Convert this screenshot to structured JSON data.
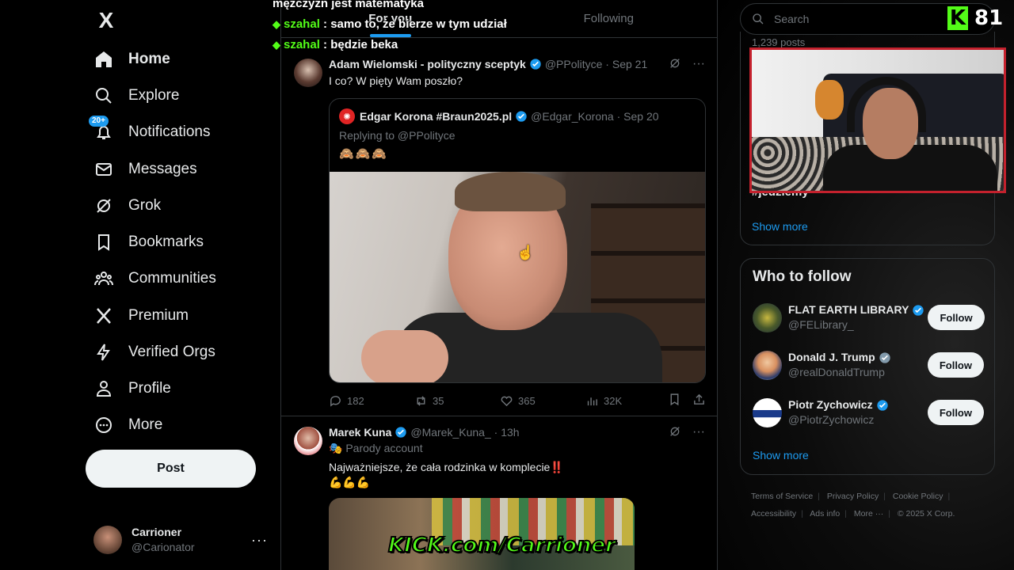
{
  "sidebar": {
    "logo": "X",
    "items": [
      {
        "label": "Home",
        "icon": "home-icon",
        "active": true
      },
      {
        "label": "Explore",
        "icon": "search-icon"
      },
      {
        "label": "Notifications",
        "icon": "bell-icon",
        "badge": "20+"
      },
      {
        "label": "Messages",
        "icon": "envelope-icon"
      },
      {
        "label": "Grok",
        "icon": "grok-icon"
      },
      {
        "label": "Bookmarks",
        "icon": "bookmark-icon"
      },
      {
        "label": "Communities",
        "icon": "people-icon"
      },
      {
        "label": "Premium",
        "icon": "x-icon"
      },
      {
        "label": "Verified Orgs",
        "icon": "lightning-icon"
      },
      {
        "label": "Profile",
        "icon": "person-icon"
      },
      {
        "label": "More",
        "icon": "more-circle-icon"
      }
    ],
    "post_button": "Post",
    "account": {
      "name": "Carrioner",
      "handle": "@Carionator",
      "more": "···"
    }
  },
  "feed": {
    "tabs": [
      {
        "label": "For you",
        "active": true
      },
      {
        "label": "Following",
        "active": false
      }
    ],
    "tweets": [
      {
        "name": "Adam Wielomski - polityczny sceptyk",
        "handle": "@PPolityce",
        "date": "Sep 21",
        "text": "I co? W pięty Wam poszło?",
        "quote": {
          "name": "Edgar Korona #Braun2025.pl",
          "handle": "@Edgar_Korona",
          "date": "Sep 20",
          "replying": "Replying to @PPolityce",
          "emoji": "🙈🙈🙈"
        },
        "stats": {
          "replies": "182",
          "reposts": "35",
          "likes": "365",
          "views": "32K"
        }
      },
      {
        "name": "Marek Kuna",
        "handle": "@Marek_Kuna_",
        "date": "13h",
        "parody": "Parody account",
        "text": "Najważniejsze, że cała rodzinka w komplecie‼️",
        "text2": "💪💪💪"
      }
    ]
  },
  "chat": {
    "lines": [
      {
        "user": "",
        "message": "mężczyzn jest matematyka"
      },
      {
        "user": "szahal",
        "message": " : samo to, że bierze w tym udział"
      },
      {
        "user": "szahal",
        "message": " : będzie beka"
      }
    ]
  },
  "overlay": {
    "kick_banner": "KICK.com/Carrioner",
    "kick_letter": "K",
    "viewer_count": "81"
  },
  "right": {
    "search_placeholder": "Search",
    "trend_posts": "1,239 posts",
    "trend_tag": "#jedziemy",
    "show_more": "Show more",
    "who_to_follow": {
      "title": "Who to follow",
      "accounts": [
        {
          "name": "FLAT EARTH LIBRARY",
          "handle": "@FELibrary_",
          "button": "Follow",
          "badge": "blue"
        },
        {
          "name": "Donald J. Trump",
          "handle": "@realDonaldTrump",
          "button": "Follow",
          "badge": "gray"
        },
        {
          "name": "Piotr Zychowicz",
          "handle": "@PiotrZychowicz",
          "button": "Follow",
          "badge": "blue"
        }
      ],
      "show_more": "Show more"
    },
    "footer": {
      "row1": [
        "Terms of Service",
        "Privacy Policy",
        "Cookie Policy"
      ],
      "row2": [
        "Accessibility",
        "Ads info",
        "More ···",
        "© 2025 X Corp."
      ]
    }
  },
  "colors": {
    "accent": "#1d9bf0",
    "kick": "#53fc18",
    "webcam_border": "#c4212d"
  }
}
